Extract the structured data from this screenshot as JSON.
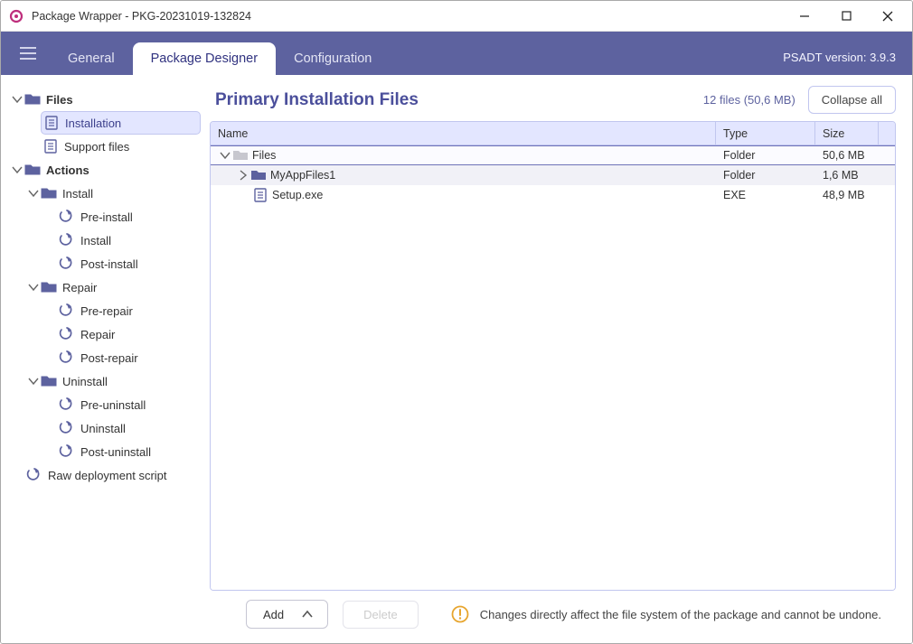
{
  "window": {
    "title": "Package Wrapper - PKG-20231019-132824"
  },
  "ribbon": {
    "tabs": {
      "general": "General",
      "designer": "Package Designer",
      "config": "Configuration"
    },
    "psadt": "PSADT version: 3.9.3"
  },
  "sidebar": {
    "files": "Files",
    "installation": "Installation",
    "support": "Support files",
    "actions": "Actions",
    "install": "Install",
    "preinstall": "Pre-install",
    "install_act": "Install",
    "postinstall": "Post-install",
    "repair": "Repair",
    "prerepair": "Pre-repair",
    "repair_act": "Repair",
    "postrepair": "Post-repair",
    "uninstall": "Uninstall",
    "preuninstall": "Pre-uninstall",
    "uninstall_act": "Uninstall",
    "postuninstall": "Post-uninstall",
    "rawscript": "Raw deployment script"
  },
  "main": {
    "title": "Primary Installation Files",
    "count": "12 files (50,6 MB)",
    "collapse": "Collapse all",
    "columns": {
      "name": "Name",
      "type": "Type",
      "size": "Size"
    },
    "rows": {
      "r0": {
        "name": "Files",
        "type": "Folder",
        "size": "50,6 MB"
      },
      "r1": {
        "name": "MyAppFiles1",
        "type": "Folder",
        "size": "1,6 MB"
      },
      "r2": {
        "name": "Setup.exe",
        "type": "EXE",
        "size": "48,9 MB"
      }
    }
  },
  "footer": {
    "add": "Add",
    "delete": "Delete",
    "warn": "Changes directly affect the file system of the package and cannot be undone."
  }
}
